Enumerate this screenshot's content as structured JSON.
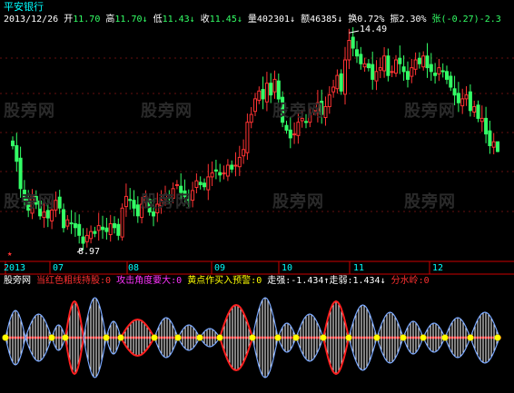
{
  "header": {
    "stock_name": "平安银行",
    "date": "2013/12/26",
    "open_label": "开",
    "open_value": "11.70",
    "high_label": "高",
    "high_value": "11.70",
    "low_label": "低",
    "low_value": "11.43",
    "close_label": "收",
    "close_value": "11.45",
    "volume_label": "量",
    "volume_value": "402301",
    "amount_label": "额",
    "amount_value": "46385",
    "turnover_label": "换",
    "turnover_value": "0.72%",
    "amplitude_label": "振",
    "amplitude_value": "2.30%",
    "change_label": "张",
    "change_value": "(-0.27)-2.3"
  },
  "annotations": {
    "high_marker": "14.49",
    "low_marker": "8.97",
    "red_marker": "★"
  },
  "months": [
    "2013",
    "07",
    "08",
    "09",
    "10",
    "11",
    "12"
  ],
  "indicator": {
    "name": "股旁网",
    "labels": [
      {
        "text": "当红色粗线持股:0",
        "color": "#ff3030"
      },
      {
        "text": "攻击角度要大:0",
        "color": "#ff33ff"
      },
      {
        "text": "黄点作买入预警:0",
        "color": "#ffff00"
      },
      {
        "text": "走强:-1.434",
        "color": "#ffffff"
      },
      {
        "text": "↑",
        "color": "#ffffff"
      },
      {
        "text": "走弱:1.434",
        "color": "#ffffff"
      },
      {
        "text": "↓",
        "color": "#ffffff"
      },
      {
        "text": "分水岭:0",
        "color": "#ff3030"
      }
    ]
  },
  "watermark": "股旁网",
  "colors": {
    "up": "#ff3333",
    "down": "#33ff66",
    "axis": "#cc0000",
    "text": "#ffffff",
    "label_cyan": "#00ffff",
    "yellow": "#ffff00"
  },
  "chart_data": {
    "type": "candlestick",
    "title": "平安银行",
    "period": "2013/06 – 2013/12",
    "range_low": 8.97,
    "range_high": 14.49,
    "last": {
      "open": 11.7,
      "high": 11.7,
      "low": 11.43,
      "close": 11.45
    },
    "closes": [
      11.6,
      11.2,
      10.5,
      10.2,
      9.95,
      10.3,
      10.1,
      9.8,
      9.9,
      9.75,
      9.95,
      10.2,
      10.0,
      9.5,
      9.7,
      9.6,
      9.5,
      9.3,
      9.1,
      9.3,
      9.4,
      9.35,
      9.55,
      9.45,
      9.4,
      9.6,
      9.5,
      9.3,
      10.0,
      10.3,
      10.2,
      10.0,
      9.8,
      10.1,
      10.3,
      9.9,
      9.8,
      10.1,
      10.2,
      10.35,
      10.25,
      10.5,
      10.6,
      10.4,
      10.3,
      10.2,
      10.45,
      10.7,
      10.6,
      10.55,
      10.8,
      10.9,
      10.95,
      10.85,
      10.9,
      11.1,
      11.0,
      11.1,
      11.3,
      11.5,
      12.2,
      12.4,
      12.8,
      13.0,
      12.8,
      13.2,
      12.9,
      13.3,
      12.8,
      12.2,
      12.0,
      11.8,
      11.9,
      12.2,
      12.3,
      12.2,
      12.4,
      12.5,
      12.7,
      12.4,
      12.6,
      12.9,
      13.1,
      13.4,
      13.0,
      13.8,
      14.3,
      14.1,
      13.9,
      13.7,
      13.7,
      13.6,
      13.3,
      13.5,
      13.6,
      13.9,
      13.4,
      13.5,
      13.8,
      13.7,
      13.5,
      13.3,
      13.6,
      13.8,
      13.7,
      13.9,
      13.6,
      13.5,
      13.4,
      13.6,
      13.5,
      13.3,
      13.1,
      12.9,
      12.7,
      12.8,
      12.9,
      12.5,
      12.6,
      12.3,
      12.3,
      11.9,
      11.6,
      11.7,
      11.45
    ]
  }
}
